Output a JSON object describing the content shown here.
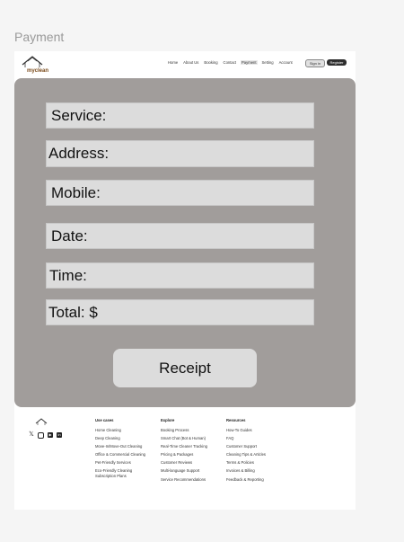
{
  "frame_label": "Payment",
  "nav": {
    "logo_text": "myclean",
    "links": [
      "Home",
      "About Us",
      "Booking",
      "Contact",
      "Payment",
      "Setting",
      "Account"
    ],
    "signin": "Sign in",
    "register": "Register"
  },
  "form": {
    "service": "Service:",
    "address": "Address:",
    "mobile": "Mobile:",
    "date": "Date:",
    "time": "Time:",
    "total": "Total: $",
    "receipt_button": "Receipt"
  },
  "footer": {
    "columns": [
      {
        "title": "Use cases",
        "items": [
          "Home Cleaning",
          "Deep Cleaning",
          "Move-In/Move-Out Cleaning",
          "Office & Commercial Cleaning",
          "Pet-Friendly Services",
          "Eco-Friendly Cleaning",
          "Subscription Plans"
        ]
      },
      {
        "title": "Explore",
        "items": [
          "Booking Process",
          "Smart Chat (Bot & Human)",
          "Real-Time Cleaner Tracking",
          "Pricing & Packages",
          "Customer Reviews",
          "Multi-language Support",
          "Service Recommendations"
        ]
      },
      {
        "title": "Resources",
        "items": [
          "How-To Guides",
          "FAQ",
          "Customer Support",
          "Cleaning Tips & Articles",
          "Terms & Policies",
          "Invoices & Billing",
          "Feedback & Reporting"
        ]
      }
    ]
  }
}
